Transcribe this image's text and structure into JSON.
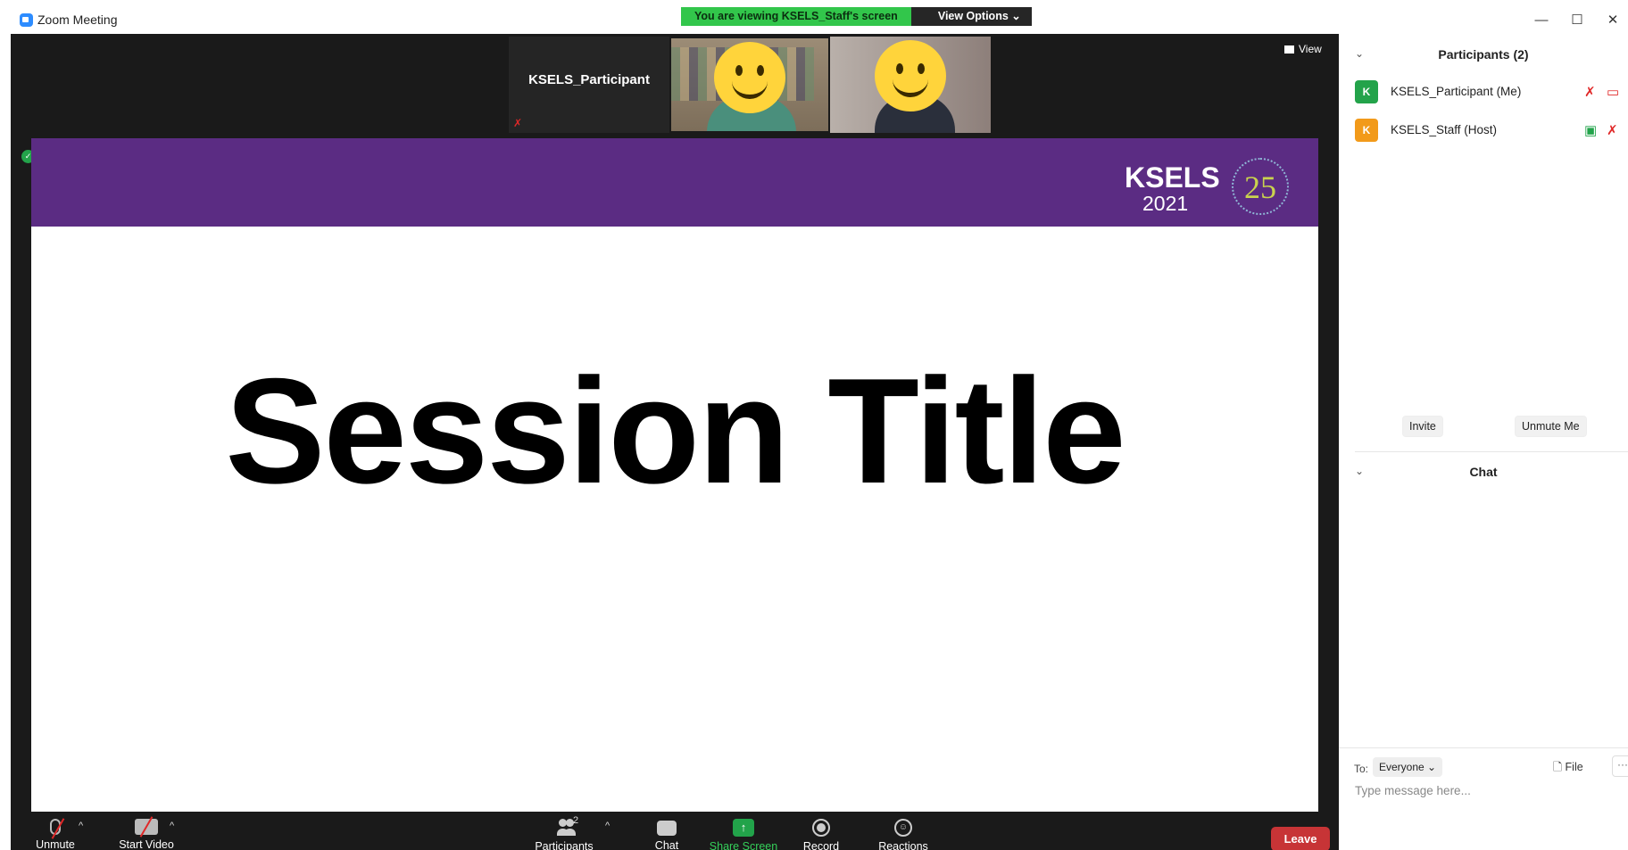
{
  "window": {
    "title": "Zoom Meeting",
    "controls": {
      "minimize": "—",
      "maximize": "☐",
      "close": "✕"
    }
  },
  "share_banner": {
    "viewing_text": "You are viewing KSELS_Staff's screen",
    "view_options": "View Options ⌄"
  },
  "video_strip": {
    "participant_name": "KSELS_Participant",
    "view_label": "View"
  },
  "slide": {
    "logo_text": "KSELS",
    "logo_year": "2021",
    "logo_badge": "25",
    "title": "Session Title"
  },
  "toolbar": {
    "unmute": "Unmute",
    "start_video": "Start Video",
    "participants": "Participants",
    "participants_count": "2",
    "chat": "Chat",
    "share_screen": "Share Screen",
    "record": "Record",
    "reactions": "Reactions",
    "leave": "Leave"
  },
  "participants_panel": {
    "title": "Participants (2)",
    "items": [
      {
        "initial": "K",
        "name": "KSELS_Participant (Me)",
        "avatar_color": "#23a34a"
      },
      {
        "initial": "K",
        "name": "KSELS_Staff (Host)",
        "avatar_color": "#f29a1a"
      }
    ],
    "invite": "Invite",
    "unmute_me": "Unmute Me"
  },
  "chat_panel": {
    "title": "Chat",
    "to_label": "To:",
    "recipient": "Everyone ⌄",
    "file": "File",
    "more": "···",
    "placeholder": "Type message here..."
  },
  "colors": {
    "slide_header": "#5b2c83",
    "banner_green": "#32c64b",
    "leave_red": "#c73436",
    "share_green": "#22a34a"
  }
}
